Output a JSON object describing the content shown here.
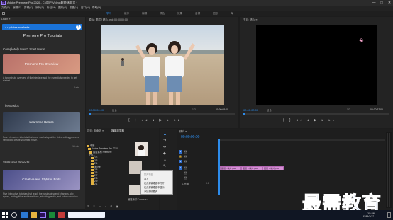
{
  "window": {
    "title": "Adobe Premiere Pro 2020 - C:\\用户\\Video\\最需\\未命名 *",
    "controls": [
      "—",
      "□",
      "✕"
    ]
  },
  "menu": [
    "文件(F)",
    "编辑(E)",
    "剪辑(C)",
    "序列(S)",
    "标记(M)",
    "图形(G)",
    "视图(V)",
    "窗口(W)",
    "帮助(H)"
  ],
  "workspaces": [
    "学习",
    "组件",
    "编辑",
    "颜色",
    "效果",
    "音频",
    "图形",
    "库"
  ],
  "learn": {
    "tab": "Learn ≡",
    "updates_label": "4 updates available",
    "header_title": "Premiere Pro Tutorials",
    "sections": [
      {
        "heading": "Completely New? Start Here!",
        "card_title": "Premiere Pro Overview",
        "desc": "A two-minute overview of the interface and the essentials needed to get started.",
        "time": "2 min",
        "colors": [
          "#b9716a",
          "#d89a82"
        ]
      },
      {
        "heading": "The Basics",
        "card_title": "Learn the Basics",
        "desc": "Four interactive tutorials that cover each step of the video editing process needed to create your first movie.",
        "time": "15 min",
        "colors": [
          "#2f3a4d",
          "#6d7b90"
        ]
      },
      {
        "heading": "Skills and Projects",
        "card_title": "Creative and Stylistic Edits",
        "desc": "Five interactive tutorials that teach the basics of speed changes, clip speed, adding titles and transitions, adjusting audio, and color correction.",
        "time": "",
        "colors": [
          "#4c4f8a",
          "#9a93c2"
        ]
      }
    ]
  },
  "source_monitor": {
    "tab": "源 Al: 图层2 精片.psd: 00:00:00:00",
    "timecode_left": "00:00:00:00",
    "fit": "适合",
    "fraction": "1/2",
    "timecode_right": "00:00:05:00"
  },
  "program_monitor": {
    "tab": "节目: 精片 ≡",
    "timecode_left": "00:00:00:00",
    "fit": "适合",
    "fraction": "1/2",
    "timecode_right": "00:00:22:00"
  },
  "project": {
    "tabs": [
      "项目: 未命名 ≡",
      "媒体浏览器"
    ],
    "tree": [
      "电脑",
      "Adobe Premiere Pro 2020",
      "最需素材 Premiere Pro...",
      "2.2",
      "2.3",
      "2.4",
      "未识别",
      "2.5",
      "2.6",
      "2.7",
      "2.8",
      "2.9",
      "2.1"
    ],
    "thumb_label": "最需素材 Premiere..."
  },
  "context_menu": [
    "打开项目",
    "导入",
    "在资源管理器中打开",
    "在资源管理器中显示",
    "添加到收藏夹"
  ],
  "timeline": {
    "tab": "精片 ≡",
    "timecode": "00:00:00:00",
    "tracks": [
      "V3",
      "V2",
      "V1",
      "A1",
      "A2",
      "A3",
      "主声道"
    ],
    "master_value": "0.0",
    "clips": [
      "图层1 精片.psd",
      "图层 3 精片.psd",
      "图层 5 精片.psd"
    ]
  },
  "taskbar": {
    "time": "15:26",
    "date": "2021/5/17"
  },
  "watermark": "最需教育"
}
